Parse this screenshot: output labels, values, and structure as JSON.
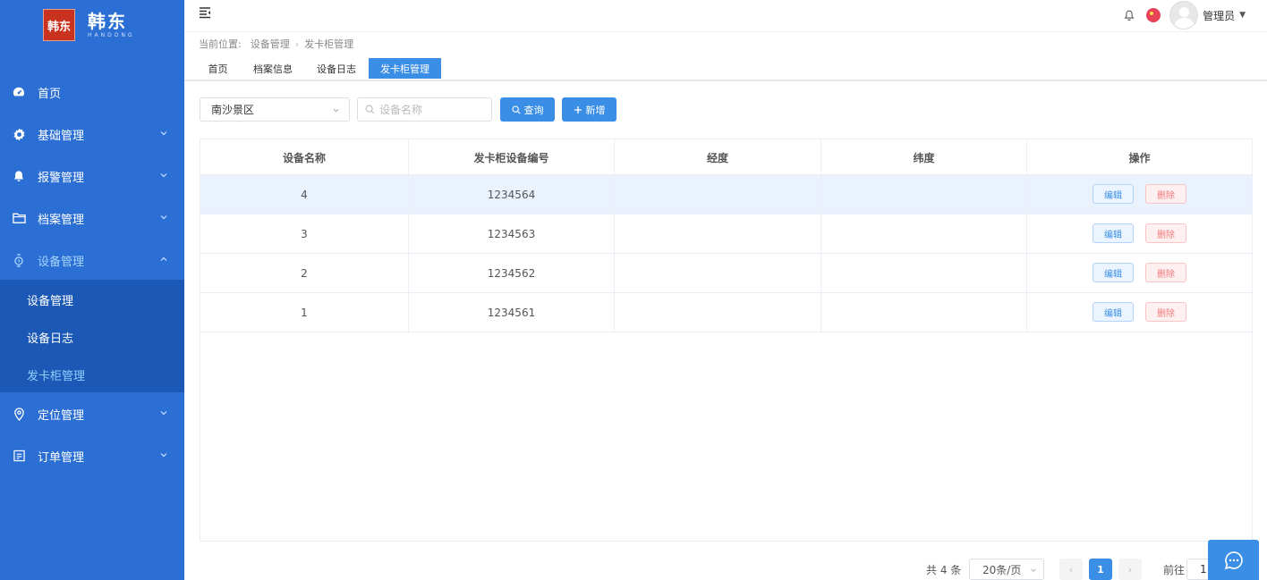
{
  "brand": {
    "seal_text": "韩东",
    "name": "韩东",
    "name_en": "HANDONG"
  },
  "sidebar": {
    "items": [
      {
        "label": "首页",
        "icon": "dashboard-icon"
      },
      {
        "label": "基础管理",
        "icon": "gear-icon"
      },
      {
        "label": "报警管理",
        "icon": "bell-icon"
      },
      {
        "label": "档案管理",
        "icon": "folder-icon"
      },
      {
        "label": "设备管理",
        "icon": "watch-icon"
      },
      {
        "label": "定位管理",
        "icon": "location-icon"
      },
      {
        "label": "订单管理",
        "icon": "order-icon"
      }
    ],
    "submenu": [
      {
        "label": "设备管理"
      },
      {
        "label": "设备日志"
      },
      {
        "label": "发卡柜管理"
      }
    ]
  },
  "header": {
    "user_name": "管理员"
  },
  "breadcrumb": {
    "prefix": "当前位置:",
    "level1": "设备管理",
    "level2": "发卡柜管理"
  },
  "tags": [
    "首页",
    "档案信息",
    "设备日志",
    "发卡柜管理"
  ],
  "filters": {
    "area_value": "南沙景区",
    "search_placeholder": "设备名称",
    "query_label": "查询",
    "add_label": "新增"
  },
  "table": {
    "columns": [
      "设备名称",
      "发卡柜设备编号",
      "经度",
      "纬度",
      "操作"
    ],
    "rows": [
      {
        "name": "4",
        "code": "1234564",
        "lng": "",
        "lat": ""
      },
      {
        "name": "3",
        "code": "1234563",
        "lng": "",
        "lat": ""
      },
      {
        "name": "2",
        "code": "1234562",
        "lng": "",
        "lat": ""
      },
      {
        "name": "1",
        "code": "1234561",
        "lng": "",
        "lat": ""
      }
    ],
    "edit_label": "编辑",
    "delete_label": "删除"
  },
  "pagination": {
    "total_text": "共 4 条",
    "page_size": "20条/页",
    "prev": "‹",
    "next": "›",
    "current_page": "1",
    "goto_label": "前往",
    "goto_value": "1"
  },
  "colors": {
    "sidebar": "#2b6fd4",
    "primary": "#3a8ee6",
    "danger": "#f07c7c"
  }
}
